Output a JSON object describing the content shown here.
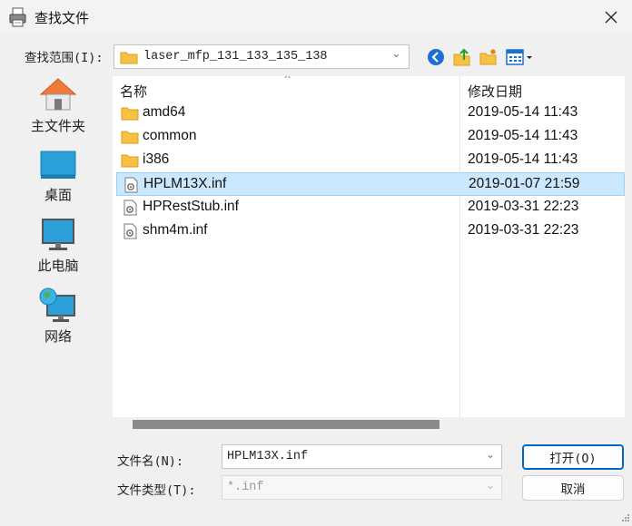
{
  "window": {
    "title": "查找文件"
  },
  "look_in": {
    "label": "查找范围(I):",
    "value": "laser_mfp_131_133_135_138"
  },
  "toolbar": [
    "back-icon",
    "up-folder-icon",
    "new-folder-icon",
    "view-menu-icon"
  ],
  "places": [
    {
      "label": "主文件夹",
      "icon": "home-icon"
    },
    {
      "label": "桌面",
      "icon": "desktop-icon"
    },
    {
      "label": "此电脑",
      "icon": "computer-icon"
    },
    {
      "label": "网络",
      "icon": "network-icon"
    }
  ],
  "file_list": {
    "columns": [
      "名称",
      "修改日期"
    ],
    "rows": [
      {
        "name": "amd64",
        "date": "2019-05-14 11:43",
        "type": "folder"
      },
      {
        "name": "common",
        "date": "2019-05-14 11:43",
        "type": "folder"
      },
      {
        "name": "i386",
        "date": "2019-05-14 11:43",
        "type": "folder"
      },
      {
        "name": "HPLM13X.inf",
        "date": "2019-01-07 21:59",
        "type": "inf-file",
        "selected": true
      },
      {
        "name": "HPRestStub.inf",
        "date": "2019-03-31 22:23",
        "type": "inf-file"
      },
      {
        "name": "shm4m.inf",
        "date": "2019-03-31 22:23",
        "type": "inf-file"
      }
    ]
  },
  "filename": {
    "label": "文件名(N):",
    "value": "HPLM13X.inf"
  },
  "filetype": {
    "label": "文件类型(T):",
    "value": "*.inf"
  },
  "buttons": {
    "open": "打开(O)",
    "cancel": "取消"
  },
  "colors": {
    "selection": "#cce8ff",
    "folder": "#f7c244",
    "accent": "#0067c0"
  }
}
